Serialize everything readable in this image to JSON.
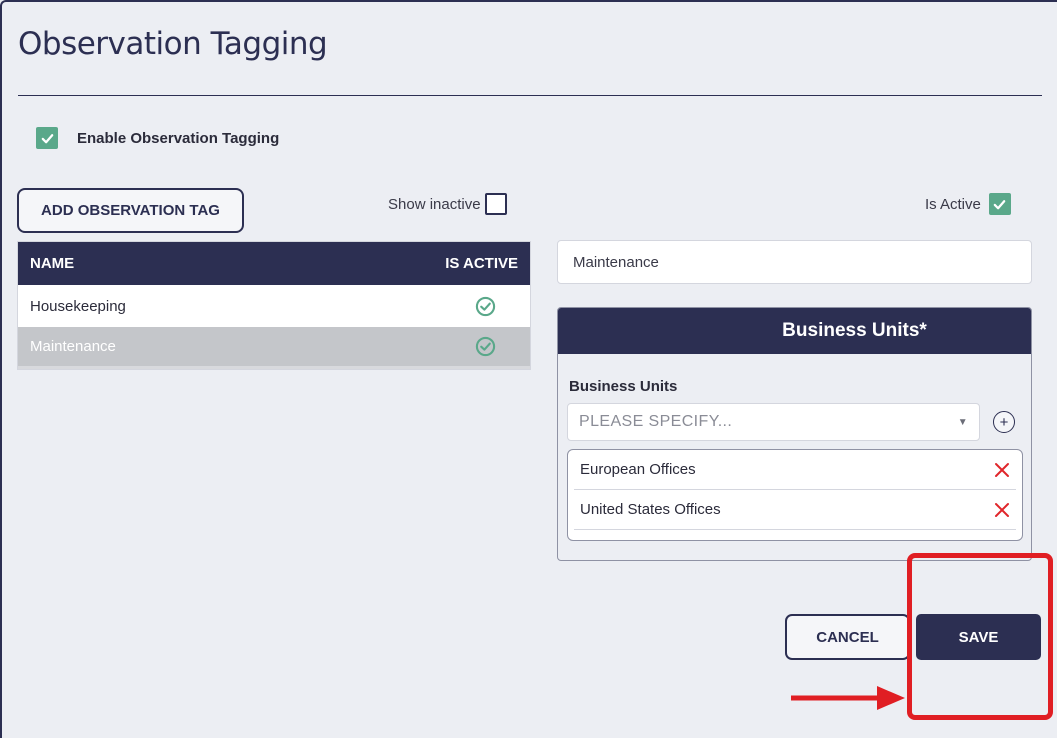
{
  "page": {
    "title": "Observation Tagging"
  },
  "enable": {
    "label": "Enable Observation Tagging",
    "checked": true
  },
  "toolbar": {
    "add_label": "ADD OBSERVATION TAG",
    "show_inactive_label": "Show inactive",
    "show_inactive_checked": false
  },
  "table": {
    "columns": [
      "NAME",
      "IS ACTIVE"
    ],
    "rows": [
      {
        "name": "Housekeeping",
        "active": true,
        "selected": false
      },
      {
        "name": "Maintenance",
        "active": true,
        "selected": true
      }
    ]
  },
  "detail": {
    "is_active_label": "Is Active",
    "is_active_checked": true,
    "name_value": "Maintenance"
  },
  "business_units": {
    "panel_title": "Business Units*",
    "field_label": "Business Units",
    "placeholder": "PLEASE SPECIFY...",
    "items": [
      "European Offices",
      "United States Offices"
    ]
  },
  "actions": {
    "cancel_label": "CANCEL",
    "save_label": "SAVE"
  },
  "colors": {
    "navy": "#2c2f52",
    "check_green": "#5aa88a",
    "remove_red": "#e0262b",
    "highlight_red": "#e01e23"
  }
}
